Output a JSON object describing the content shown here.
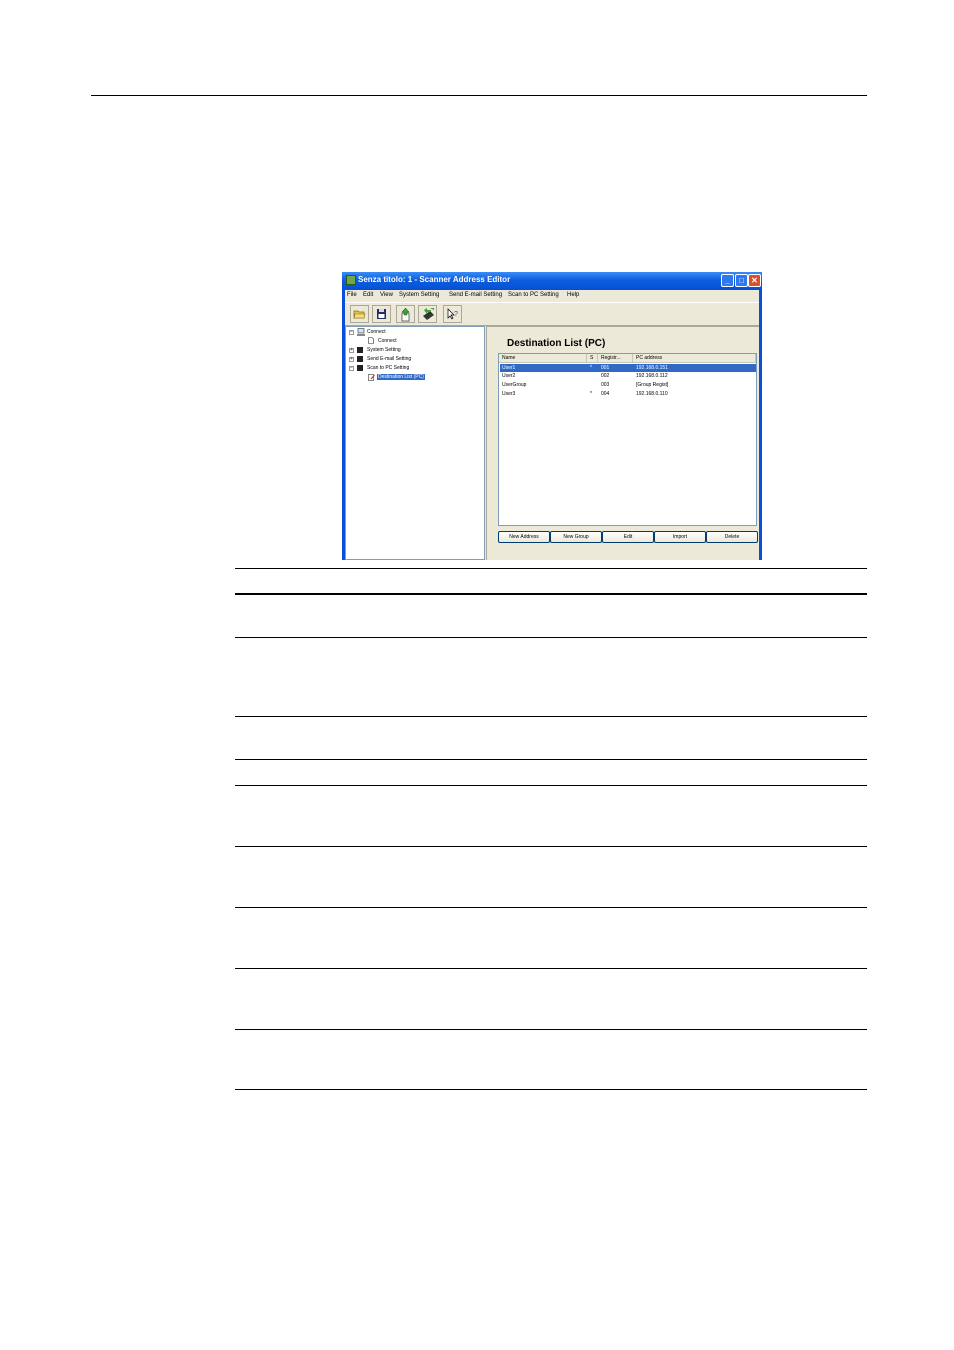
{
  "window": {
    "title": "Senza titolo: 1 - Scanner Address Editor",
    "minimize": "_",
    "maximize": "□",
    "close": "✕"
  },
  "menu": [
    "File",
    "Edit",
    "View",
    "System Setting",
    "Send E-mail Setting",
    "Scan to PC Setting",
    "Help"
  ],
  "toolbar": {
    "icons": [
      "open-folder-icon",
      "save-disk-icon",
      "upload-icon",
      "send-device-icon",
      "help-pointer-icon"
    ]
  },
  "tree": {
    "expand_collapsed": "+",
    "expand_open": "−",
    "items": [
      {
        "label": "Connect",
        "icon": "computer-icon"
      },
      {
        "label": "Connect",
        "icon": "document-icon"
      },
      {
        "label": "System Setting",
        "icon": "device-icon"
      },
      {
        "label": "Send E-mail Setting",
        "icon": "device-icon"
      },
      {
        "label": "Scan to PC Setting",
        "icon": "device-icon"
      },
      {
        "label": "Destination List (PC)",
        "icon": "edit-document-icon",
        "selected": true
      }
    ]
  },
  "panel": {
    "title": "Destination List (PC)",
    "columns": [
      "Name",
      "S",
      "Registr...",
      "PC address"
    ],
    "rows": [
      {
        "name": "User1",
        "s": "*",
        "reg": "001",
        "address": "192.168.0.151",
        "selected": true
      },
      {
        "name": "User2",
        "s": "",
        "reg": "002",
        "address": "192.168.0.112",
        "selected": false
      },
      {
        "name": "UserGroup",
        "s": "",
        "reg": "003",
        "address": "[Group Regist]",
        "selected": false
      },
      {
        "name": "User3",
        "s": "*",
        "reg": "004",
        "address": "192.168.0.110",
        "selected": false
      }
    ],
    "buttons": [
      "New Address",
      "New Group",
      "Edit",
      "Import",
      "Delete"
    ]
  },
  "colors": {
    "title_bar": "#0c5ee0",
    "selection": "#316ac5",
    "window_face": "#ece9d8"
  }
}
